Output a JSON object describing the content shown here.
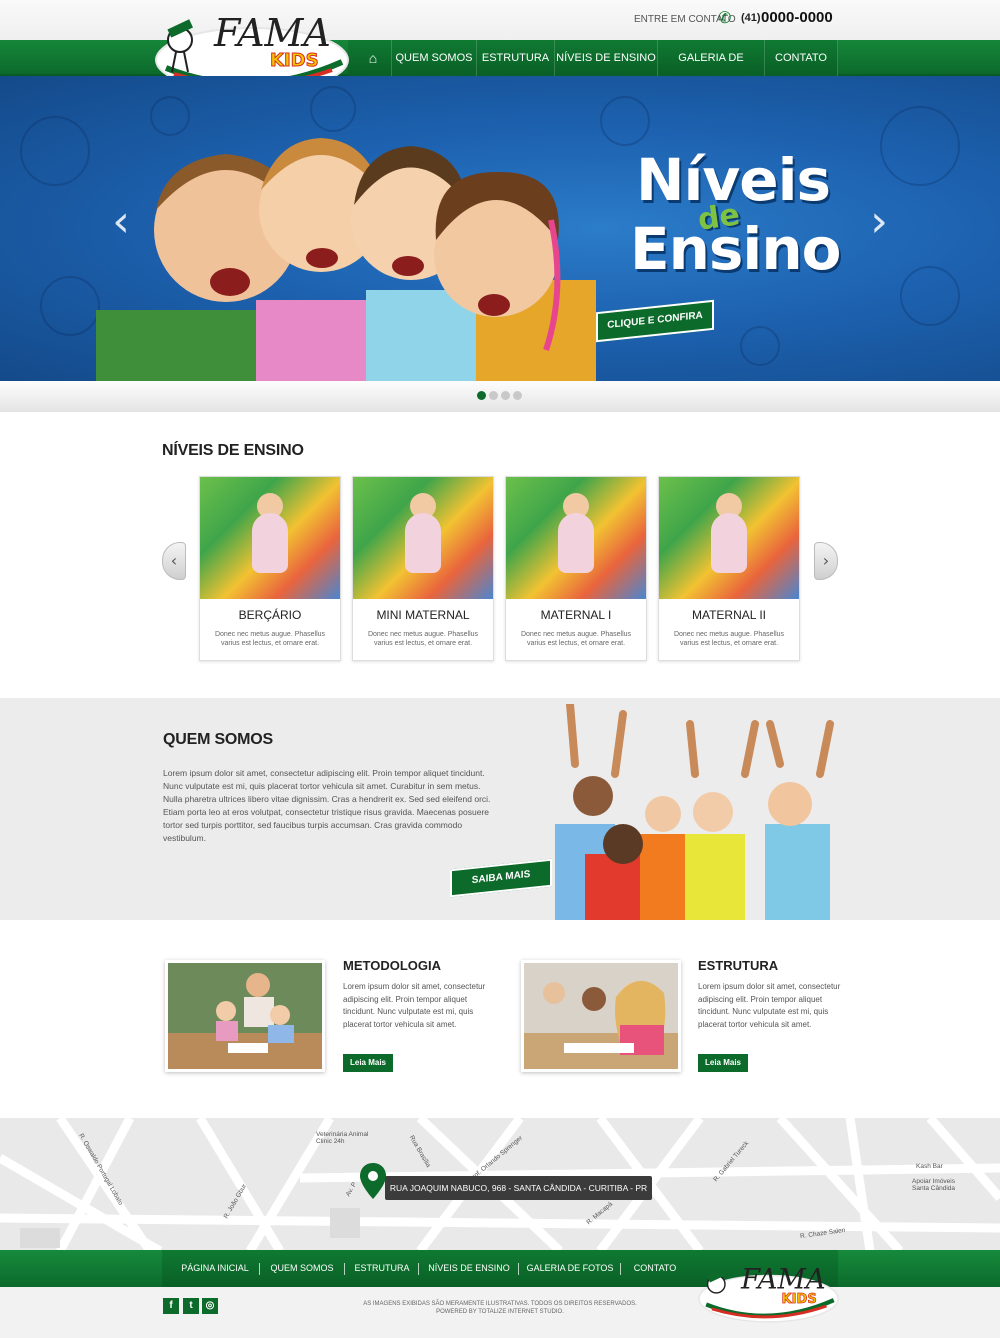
{
  "header": {
    "contact_label": "ENTRE EM CONTATO",
    "phone_area": "(41)",
    "phone_number": "0000-0000",
    "logo_text": "FAMA",
    "logo_sub": "KIDS"
  },
  "nav": {
    "items": [
      {
        "label": "QUEM SOMOS"
      },
      {
        "label": "ESTRUTURA"
      },
      {
        "label": "NÍVEIS DE ENSINO"
      },
      {
        "label": "GALERIA DE FOTOS"
      },
      {
        "label": "CONTATO"
      }
    ]
  },
  "hero": {
    "title_line1": "Níveis",
    "title_connector": "de",
    "title_line2": "Ensino",
    "cta": "CLIQUE E CONFIRA",
    "slide_count": 4,
    "active_slide": 1
  },
  "levels": {
    "title": "NÍVEIS DE ENSINO",
    "cards": [
      {
        "title": "BERÇÁRIO",
        "desc": "Donec nec metus augue. Phasellus varius est lectus, et ornare erat."
      },
      {
        "title": "MINI MATERNAL",
        "desc": "Donec nec metus augue. Phasellus varius est lectus, et ornare erat."
      },
      {
        "title": "MATERNAL I",
        "desc": "Donec nec metus augue. Phasellus varius est lectus, et ornare erat."
      },
      {
        "title": "MATERNAL II",
        "desc": "Donec nec metus augue. Phasellus varius est lectus, et ornare erat."
      }
    ]
  },
  "about": {
    "title": "QUEM SOMOS",
    "text": "Lorem ipsum dolor sit amet, consectetur adipiscing elit. Proin tempor aliquet tincidunt. Nunc vulputate est mi, quis placerat tortor vehicula sit amet. Curabitur in sem metus. Nulla pharetra ultrices libero vitae dignissim. Cras a hendrerit ex. Sed sed eleifend orci. Etiam porta leo at eros volutpat, consectetur tristique risus gravida. Maecenas posuere tortor sed turpis porttitor, sed faucibus turpis accumsan. Cras gravida commodo vestibulum.",
    "cta": "SAIBA MAIS"
  },
  "features": [
    {
      "title": "METODOLOGIA",
      "text": "Lorem ipsum dolor sit amet, consectetur adipiscing elit. Proin tempor aliquet tincidunt. Nunc vulputate est mi, quis placerat tortor vehicula sit amet.",
      "button": "Leia Mais"
    },
    {
      "title": "ESTRUTURA",
      "text": "Lorem ipsum dolor sit amet, consectetur adipiscing elit. Proin tempor aliquet tincidunt. Nunc vulputate est mi, quis placerat tortor vehicula sit amet.",
      "button": "Leia Mais"
    }
  ],
  "map": {
    "address": "RUA JOAQUIM NABUCO, 968 - SANTA CÂNDIDA - CURITIBA - PR",
    "labels": [
      "Veterinária Animal Clinic 24h",
      "Kash Bar",
      "Apoiar Imóveis Santa Cândida",
      "R. Chaze Salen",
      "R. Gabriel Tureck",
      "R. Macapá",
      "R. João Gbur",
      "Av. P",
      "R. Prof. Orlando Sprenger",
      "R. Oswaldo Portugal Lobato",
      "Rua Brasília"
    ]
  },
  "footer": {
    "nav": [
      "PÁGINA INICIAL",
      "QUEM SOMOS",
      "ESTRUTURA",
      "NÍVEIS DE ENSINO",
      "GALERIA DE FOTOS",
      "CONTATO"
    ],
    "copyright_1": "AS IMAGENS EXIBIDAS SÃO MERAMENTE ILUSTRATIVAS. TODOS OS DIREITOS RESERVADOS.",
    "copyright_2": "POWERED BY TOTALIZE INTERNET STUDIO.",
    "social": [
      {
        "icon": "facebook-icon",
        "glyph": "f"
      },
      {
        "icon": "twitter-icon",
        "glyph": "t"
      },
      {
        "icon": "instagram-icon",
        "glyph": "◎"
      }
    ]
  },
  "colors": {
    "brand_green": "#0c6a2b",
    "hero_blue": "#1d62b0",
    "logo_red": "#d62e22",
    "logo_yellow": "#f5c400"
  }
}
